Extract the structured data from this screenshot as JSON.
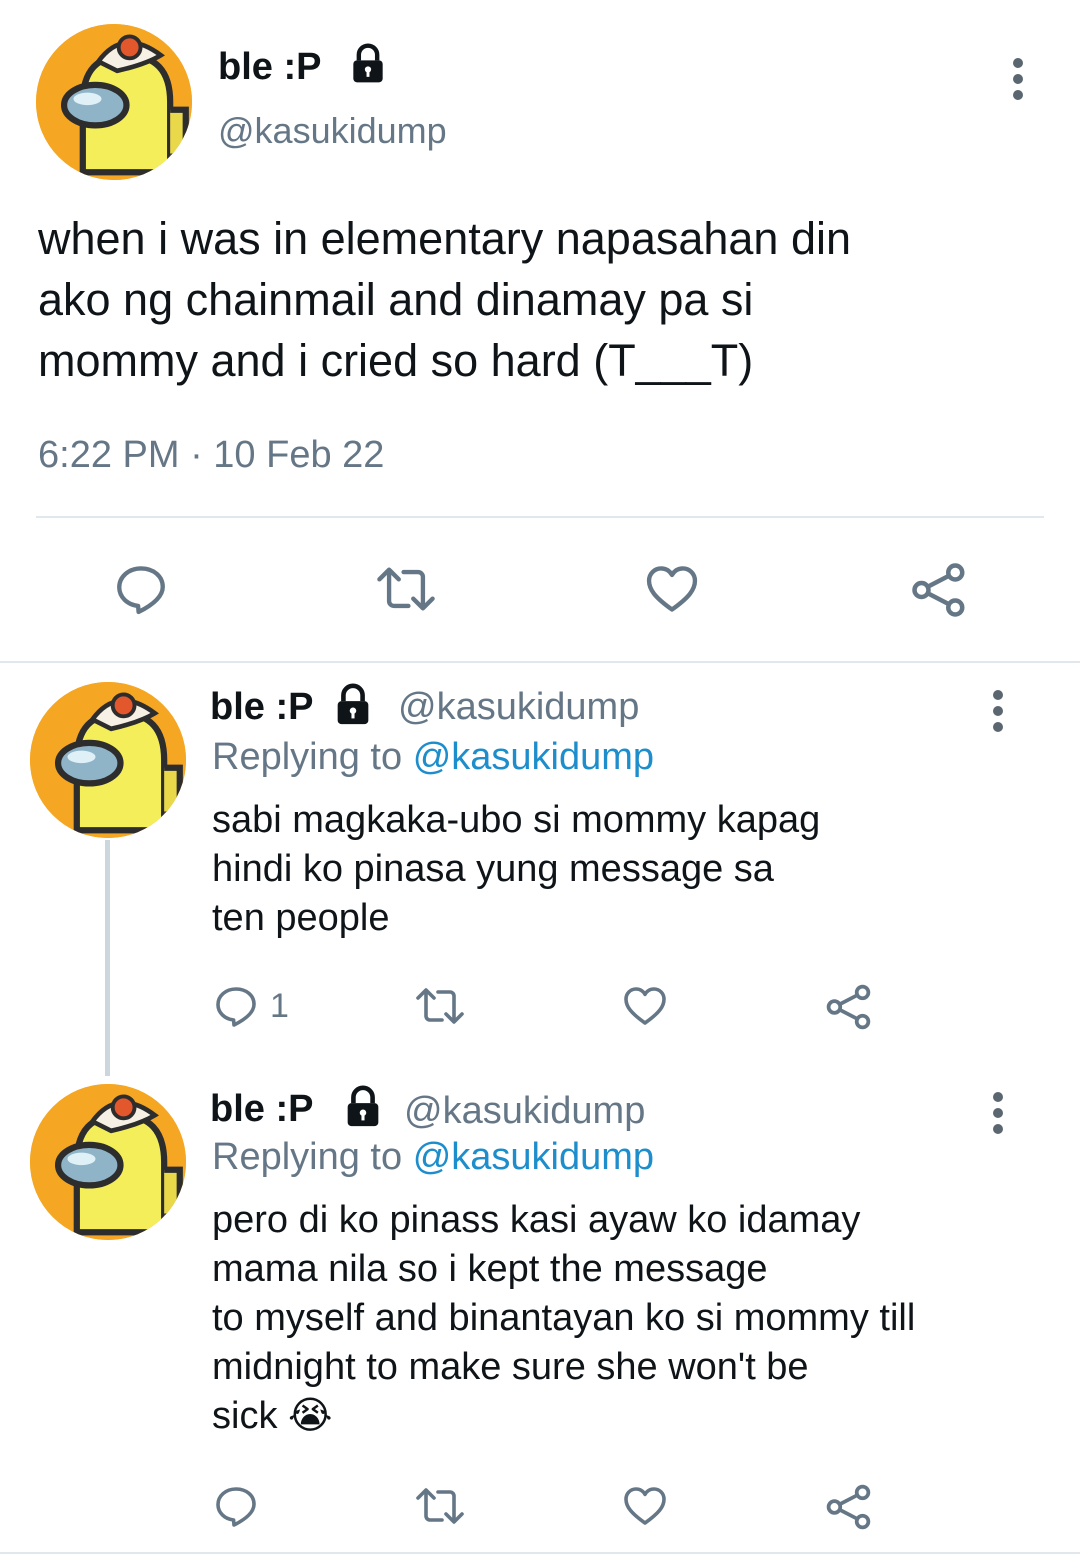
{
  "main_tweet": {
    "display_name": "ble :P",
    "handle": "@kasukidump",
    "text_lines": [
      "when i was in elementary napasahan din",
      "ako ng chainmail and dinamay pa si",
      "mommy and i cried so hard (T___T)"
    ],
    "timestamp": "6:22 PM · 10 Feb 22"
  },
  "replies": [
    {
      "display_name": "ble :P",
      "handle": "@kasukidump",
      "replying_prefix": "Replying to",
      "replying_to": "@kasukidump",
      "text_lines": [
        "sabi magkaka-ubo si mommy kapag",
        "hindi ko pinasa yung message sa",
        "ten people"
      ],
      "reply_count": "1"
    },
    {
      "display_name": "ble :P",
      "handle": "@kasukidump",
      "replying_prefix": "Replying to",
      "replying_to": "@kasukidump",
      "text_lines": [
        "pero di ko pinass kasi ayaw ko idamay",
        "mama nila so i kept the message",
        "to myself and binantayan ko si mommy till",
        "midnight to make sure she won't be",
        "sick"
      ],
      "emoji": "😭",
      "reply_count": ""
    }
  ],
  "icons": {
    "reply": "reply-icon",
    "retweet": "retweet-icon",
    "like": "heart-icon",
    "share": "share-icon",
    "lock": "lock-icon",
    "more": "more-options-icon"
  },
  "colors": {
    "text": "#0f1419",
    "secondary": "#657786",
    "link": "#1d8ecb",
    "icon": "#657786",
    "avatar_bg": "#f5a623",
    "crewmate": "#f4ee5a"
  }
}
